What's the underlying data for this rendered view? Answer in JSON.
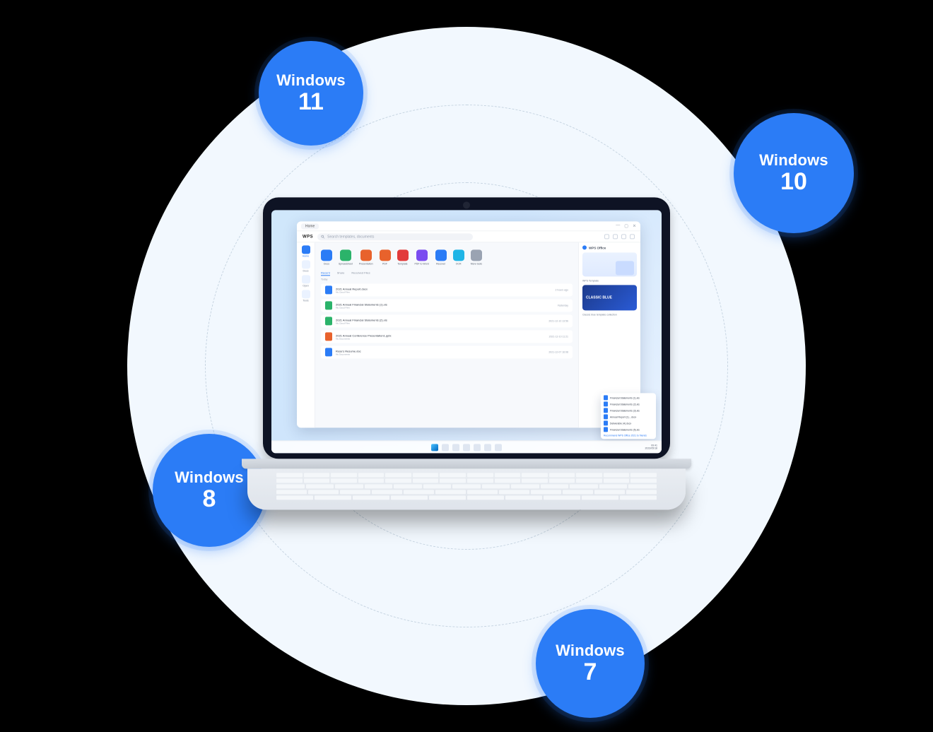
{
  "badges": [
    {
      "label": "Windows",
      "version": "11"
    },
    {
      "label": "Windows",
      "version": "10"
    },
    {
      "label": "Windows",
      "version": "8"
    },
    {
      "label": "Windows",
      "version": "7"
    }
  ],
  "tiles": {
    "colors": [
      "#2B7CF6",
      "#2BB36A",
      "#E8622C",
      "#E8622C",
      "#E23B3B",
      "#7A4CF0",
      "#2B7CF6",
      "#20B5E6",
      "#9AA3B2"
    ]
  },
  "app": {
    "tabTitle": "Home",
    "logo": "WPS",
    "searchPlaceholder": "Search templates, documents",
    "sidebar": [
      {
        "label": "Home",
        "active": true
      },
      {
        "label": "Docs"
      },
      {
        "label": "Open"
      },
      {
        "label": "Tools"
      }
    ],
    "tileLabels": [
      "Docs",
      "Spreadsheet",
      "Presentation",
      "PDF",
      "Template",
      "PDF to Word",
      "Recover",
      "OCR",
      "More tools"
    ],
    "listTabs": {
      "items": [
        "Recent",
        "Share",
        "Received Files"
      ],
      "activeIndex": 0
    },
    "sectionLabel": "Today",
    "files": [
      {
        "name": "2021 Annual Report.docx",
        "path": "My Cloud Files",
        "date": "2 hours ago",
        "color": "#2B7CF6"
      },
      {
        "name": "2021 Annual Financial Statements (1).xls",
        "path": "My Cloud Files",
        "date": "Yesterday",
        "color": "#2BB36A"
      },
      {
        "name": "2021 Annual Financial Statements (2).xls",
        "path": "My Cloud Files",
        "date": "2021-12-10 13:56",
        "color": "#2BB36A"
      },
      {
        "name": "2021 Annual Conference Presentation1.pptx",
        "path": "My Documents",
        "date": "2021-12-10 11:21",
        "color": "#E8622C"
      },
      {
        "name": "Rose's Resume.doc",
        "path": "My Documents",
        "date": "2021-12-07 16:08",
        "color": "#2B7CF6"
      }
    ],
    "rightPanel": {
      "title": "WPS Office",
      "sub1": "WPS Template",
      "promoLabel": "CLASSIC BLUE",
      "sub2": "Classic blue template collection"
    },
    "popup": {
      "items": [
        "Financial Statements (1).xls",
        "Financial Statements (2).xls",
        "Financial Statements (3).xls",
        "Annual Report (1)…docx",
        "Deliverable (4).docx",
        "Financial Statements (5).xls"
      ],
      "cta": "Recommend WPS Office 2021 to friends"
    },
    "clock": {
      "time": "09:41",
      "date": "2023/05/18"
    }
  }
}
